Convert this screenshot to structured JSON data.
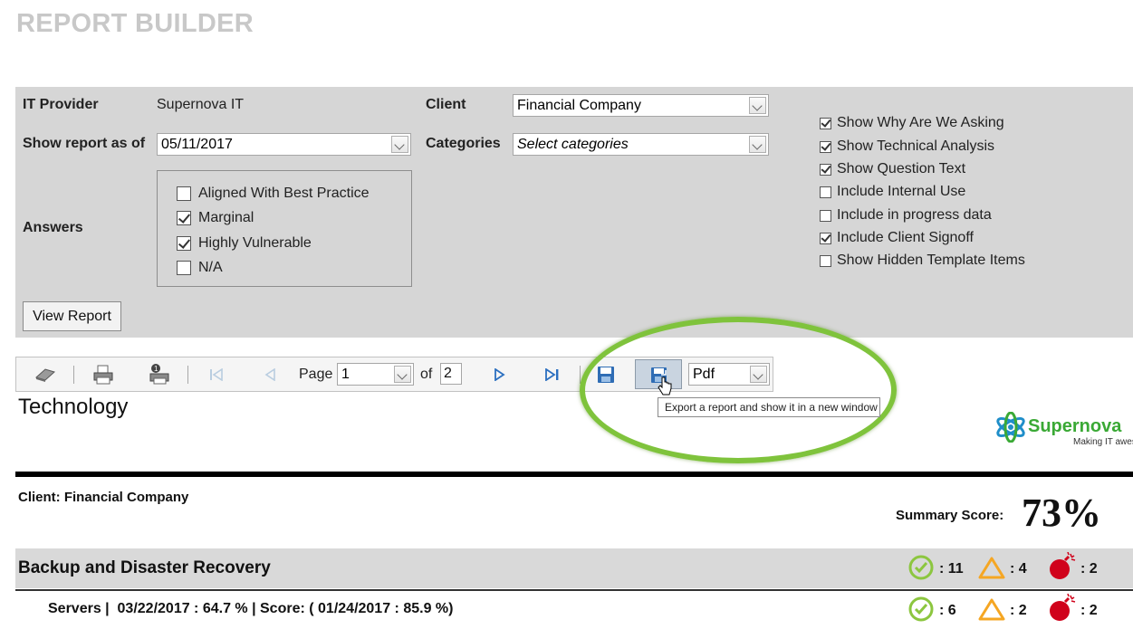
{
  "app": {
    "title": "REPORT BUILDER"
  },
  "form": {
    "it_provider_label": "IT Provider",
    "it_provider_value": "Supernova IT",
    "show_report_label": "Show report as of",
    "show_report_value": "05/11/2017",
    "client_label": "Client",
    "client_value": "Financial Company",
    "categories_label": "Categories",
    "categories_placeholder": "Select categories",
    "answers_label": "Answers",
    "answers": [
      {
        "label": "Aligned With Best Practice",
        "checked": false
      },
      {
        "label": "Marginal",
        "checked": true
      },
      {
        "label": "Highly Vulnerable",
        "checked": true
      },
      {
        "label": "N/A",
        "checked": false
      }
    ],
    "options": [
      {
        "label": "Show Why Are We Asking",
        "checked": true
      },
      {
        "label": "Show Technical Analysis",
        "checked": true
      },
      {
        "label": "Show Question Text",
        "checked": true
      },
      {
        "label": "Include Internal Use",
        "checked": false
      },
      {
        "label": "Include in progress data",
        "checked": false
      },
      {
        "label": "Include Client Signoff",
        "checked": true
      },
      {
        "label": "Show Hidden Template Items",
        "checked": false
      }
    ],
    "view_report_label": "View Report"
  },
  "toolbar": {
    "page_label": "Page",
    "page_value": "1",
    "of_label": "of",
    "total_pages": "2",
    "export_format": "Pdf",
    "export_tooltip": "Export a report and show it in a new window"
  },
  "report": {
    "section_title": "Technology",
    "logo_text": "Supernova",
    "logo_tagline": "Making IT aweso",
    "client_line": "Client: Financial Company",
    "summary_label": "Summary Score:",
    "summary_value": "73%",
    "category": {
      "title": "Backup and Disaster Recovery",
      "counts": {
        "ok": ": 11",
        "warn": ": 4",
        "bad": ": 2"
      }
    },
    "subrow": {
      "text": "Servers |  03/22/2017 : 64.7 % | Score: ( 01/24/2017 : 85.9 %)",
      "counts": {
        "ok": ": 6",
        "warn": ": 2",
        "bad": ": 2"
      }
    }
  },
  "colors": {
    "highlight_ring": "#7fc33c",
    "ok_icon": "#8cc63f",
    "warn_icon": "#f5a623",
    "bad_icon": "#d0021b",
    "logo_blue": "#1f8ec9",
    "logo_green": "#3aa935"
  }
}
